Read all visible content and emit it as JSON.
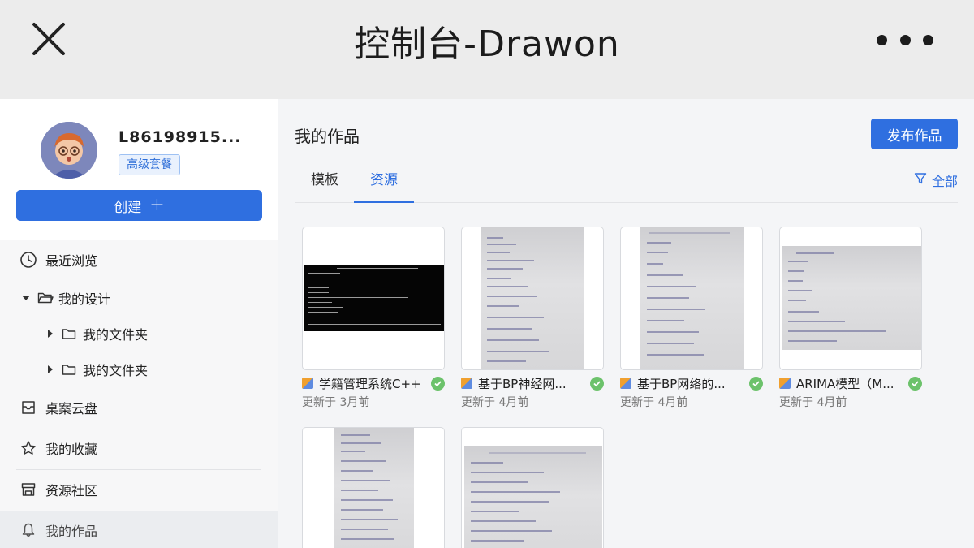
{
  "header": {
    "title": "控制台-Drawon"
  },
  "profile": {
    "username": "L86198915...",
    "plan_badge": "高级套餐"
  },
  "create_button": {
    "label": "创建",
    "plus": "+"
  },
  "nav": {
    "recent": "最近浏览",
    "my_designs": "我的设计",
    "folder_1": "我的文件夹",
    "folder_2": "我的文件夹",
    "cloud": "桌案云盘",
    "favorites": "我的收藏",
    "community": "资源社区",
    "my_works": "我的作品"
  },
  "main": {
    "title": "我的作品",
    "publish_label": "发布作品",
    "tabs": [
      {
        "label": "模板"
      },
      {
        "label": "资源"
      }
    ],
    "active_tab": "资源",
    "filter_label": "全部"
  },
  "works": [
    {
      "name": "学籍管理系统C++",
      "updated": "更新于 3月前"
    },
    {
      "name": "基于BP神经网...",
      "updated": "更新于 4月前"
    },
    {
      "name": "基于BP网络的...",
      "updated": "更新于 4月前"
    },
    {
      "name": "ARIMA模型（M...",
      "updated": "更新于 4月前"
    },
    {
      "name": "",
      "updated": ""
    },
    {
      "name": "",
      "updated": ""
    }
  ],
  "colors": {
    "accent": "#2f6fe0",
    "success": "#6cc26b"
  }
}
